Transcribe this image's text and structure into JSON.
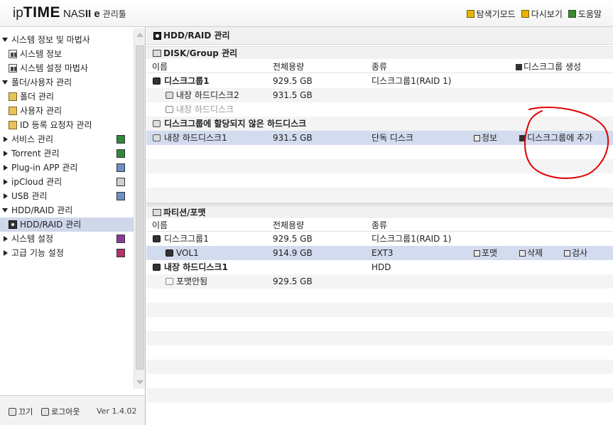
{
  "header": {
    "logo_ip": "ip",
    "logo_time": "TIME",
    "logo_nas": "NAS",
    "logo_model": "II e",
    "logo_manager": "관리툴",
    "links": [
      {
        "label": "탐색기모드",
        "icon": "folder-icon"
      },
      {
        "label": "다시보기",
        "icon": "refresh-icon"
      },
      {
        "label": "도움말",
        "icon": "help-icon"
      }
    ]
  },
  "sidebar": {
    "items": [
      {
        "label": "시스템 정보 및 마법사",
        "level": 0,
        "expanded": true
      },
      {
        "label": "시스템 정보",
        "level": 1,
        "icon": "chart-icon"
      },
      {
        "label": "시스템 설정 마법사",
        "level": 1,
        "icon": "chart-icon"
      },
      {
        "label": "폴더/사용자 관리",
        "level": 0,
        "expanded": true
      },
      {
        "label": "폴더 관리",
        "level": 1,
        "icon": "folder-icon"
      },
      {
        "label": "사용자 관리",
        "level": 1,
        "icon": "folder-icon"
      },
      {
        "label": "ID 등록 요청자 관리",
        "level": 1,
        "icon": "folder-icon"
      },
      {
        "label": "서비스 관리",
        "level": 0,
        "expanded": false,
        "badge": "green"
      },
      {
        "label": "Torrent 관리",
        "level": 0,
        "expanded": false,
        "badge": "green"
      },
      {
        "label": "Plug-in APP 관리",
        "level": 0,
        "expanded": false,
        "badge": "blue"
      },
      {
        "label": "ipCloud 관리",
        "level": 0,
        "expanded": false,
        "badge": "gray"
      },
      {
        "label": "USB 관리",
        "level": 0,
        "expanded": false,
        "badge": "blue"
      },
      {
        "label": "HDD/RAID 관리",
        "level": 0,
        "expanded": true
      },
      {
        "label": "HDD/RAID 관리",
        "level": 1,
        "icon": "hdd-icon",
        "active": true
      },
      {
        "label": "시스템 설정",
        "level": 0,
        "expanded": false,
        "badge": "purple"
      },
      {
        "label": "고급 기능 설정",
        "level": 0,
        "expanded": false,
        "badge": "pink"
      }
    ],
    "footer": {
      "power_label": "끄기",
      "logout_label": "로그아웃",
      "version": "Ver 1.4.02"
    }
  },
  "main": {
    "title": "HDD/RAID 관리",
    "disk_section": {
      "title": "DISK/Group 관리",
      "columns": {
        "name": "이름",
        "capacity": "전체용량",
        "type": "종류",
        "create_group": "디스크그룹 생성"
      },
      "rows": [
        {
          "name": "디스크그룹1",
          "capacity": "929.5 GB",
          "type": "디스크그룹1(RAID 1)"
        },
        {
          "name": "내장 하드디스크2",
          "capacity": "931.5 GB",
          "type": ""
        },
        {
          "name": "내장 하드디스크",
          "capacity": "",
          "type": ""
        },
        {
          "name": "디스크그룹에 할당되지 않은 하드디스크",
          "capacity": "",
          "type": ""
        },
        {
          "name": "내장 하드디스크1",
          "capacity": "931.5 GB",
          "type": "단독 디스크",
          "info": "정보",
          "add": "디스크그룹에 추가"
        }
      ]
    },
    "partition_section": {
      "title": "파티션/포맷",
      "columns": {
        "name": "이름",
        "capacity": "전체용량",
        "type": "종류"
      },
      "rows": [
        {
          "name": "디스크그룹1",
          "capacity": "929.5 GB",
          "type": "디스크그룹1(RAID 1)"
        },
        {
          "name": "VOL1",
          "capacity": "914.9 GB",
          "type": "EXT3",
          "format": "포맷",
          "delete": "삭제",
          "check": "검사"
        },
        {
          "name": "내장 하드디스크1",
          "capacity": "",
          "type": "HDD"
        },
        {
          "name": "포맷안됨",
          "capacity": "929.5 GB",
          "type": ""
        }
      ]
    }
  },
  "colors": {
    "selected_row": "#d3dbee",
    "alt_row": "#f4f4f4",
    "annotation": "#e00000"
  }
}
